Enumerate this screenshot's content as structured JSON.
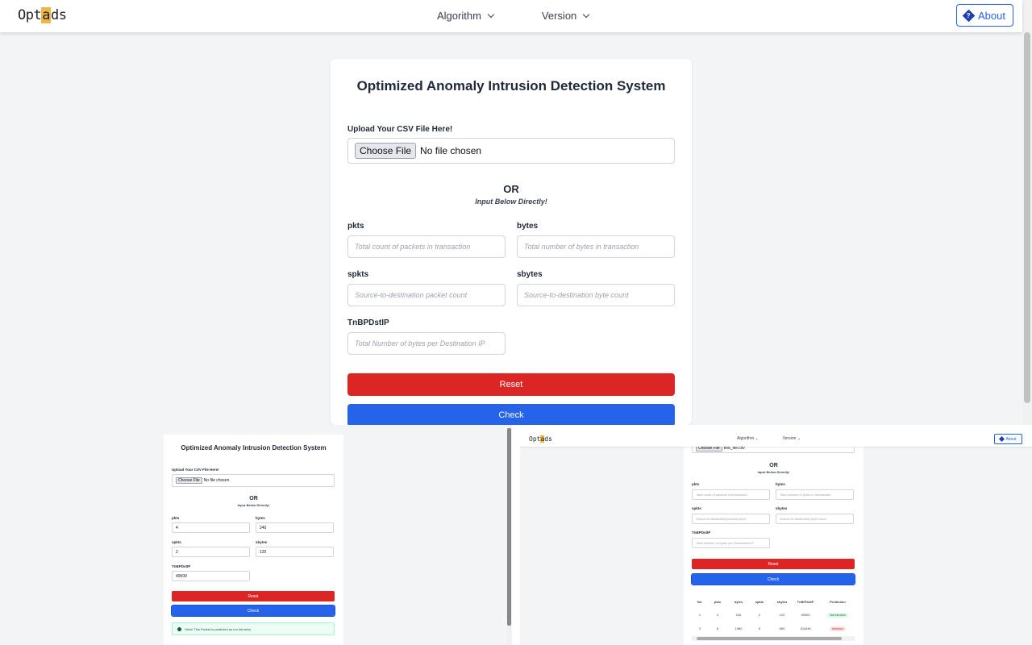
{
  "nav": {
    "logo_pre": "Opt",
    "logo_hl": "a",
    "logo_post": "ds",
    "menu": [
      {
        "label": "Algorithm"
      },
      {
        "label": "Version"
      }
    ],
    "about_label": "About",
    "about_icon": "question-diamond-icon"
  },
  "form": {
    "title": "Optimized Anomaly Intrusion Detection System",
    "upload_label": "Upload Your CSV File Here!",
    "choose_file": "Choose File",
    "no_file": "No file chosen",
    "or": "OR",
    "or_sub": "Input Below Directly!",
    "fields": [
      {
        "label": "pkts",
        "placeholder": "Total count of packets in transaction"
      },
      {
        "label": "bytes",
        "placeholder": "Total number of bytes in transaction"
      },
      {
        "label": "spkts",
        "placeholder": "Source-to-destination packet count"
      },
      {
        "label": "sbytes",
        "placeholder": "Source-to-destination byte count"
      },
      {
        "label": "TnBPDstIP",
        "placeholder": "Total Number of bytes per Destination IP"
      }
    ],
    "reset": "Reset",
    "check": "Check",
    "colors": {
      "reset": "#dc2626",
      "check": "#2563eb"
    }
  },
  "shot_left": {
    "values": [
      "4",
      "240",
      "2",
      "120",
      "49500"
    ],
    "alert": "Hello! This Packet is predicted as not Intrusion"
  },
  "shot_right": {
    "file_name": "test_file.csv",
    "table": {
      "headers": [
        "No.",
        "pkts",
        "bytes",
        "spkts",
        "sbytes",
        "TnBPDstIP",
        "Prediction"
      ],
      "rows": [
        [
          "1",
          "4",
          "240",
          "2",
          "120",
          "49500",
          "Not Intrusion"
        ],
        [
          "2",
          "8",
          "1980",
          "5",
          "650",
          "201845",
          "Intrusion"
        ]
      ]
    }
  }
}
